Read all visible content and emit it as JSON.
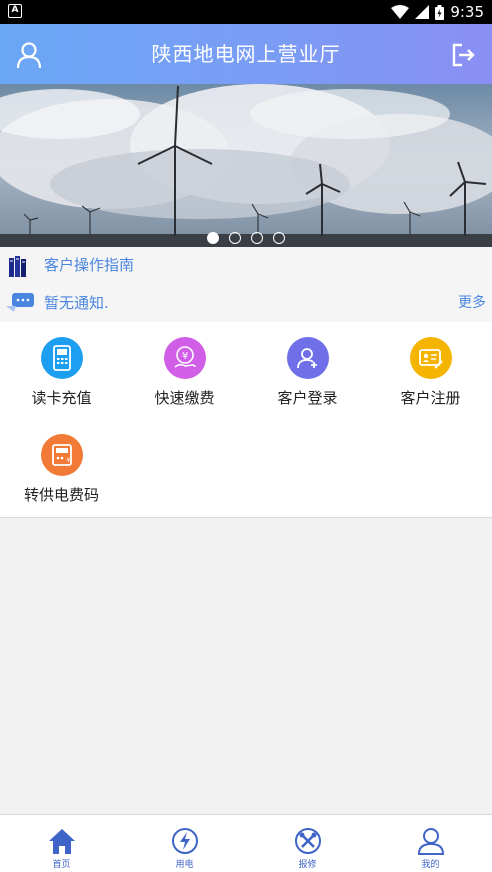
{
  "status_bar": {
    "time": "9:35"
  },
  "header": {
    "title": "陕西地电网上营业厅"
  },
  "banner": {
    "slide_count": 4,
    "active_index": 0
  },
  "guide": {
    "text": "客户操作指南"
  },
  "notice": {
    "text": "暂无通知.",
    "more_label": "更多"
  },
  "services": [
    {
      "label": "读卡充值",
      "icon": "card-reader-icon",
      "color": "#1e9ef0"
    },
    {
      "label": "快速缴费",
      "icon": "yuan-hand-icon",
      "color": "#d05ee6"
    },
    {
      "label": "客户登录",
      "icon": "user-add-icon",
      "color": "#6f6fe8"
    },
    {
      "label": "客户注册",
      "icon": "id-card-icon",
      "color": "#f5b400"
    },
    {
      "label": "转供电费码",
      "icon": "meter-icon",
      "color": "#f07a36"
    }
  ],
  "bottom_nav": [
    {
      "label": "首页",
      "icon": "home-icon"
    },
    {
      "label": "用电",
      "icon": "lightning-icon"
    },
    {
      "label": "报修",
      "icon": "repair-icon"
    },
    {
      "label": "我的",
      "icon": "profile-icon"
    }
  ],
  "colors": {
    "accent": "#4a86e0",
    "nav_active": "#3f64c8"
  }
}
